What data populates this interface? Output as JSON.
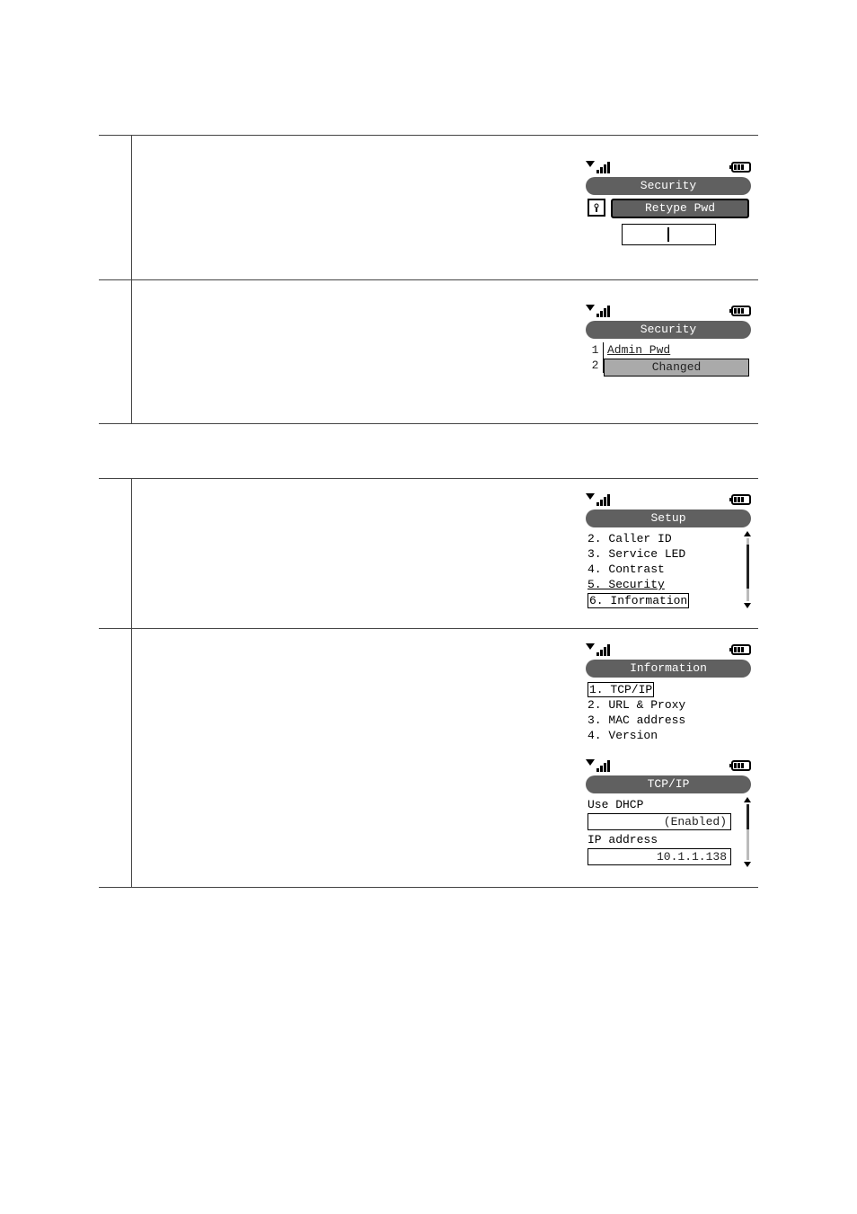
{
  "screen1": {
    "title": "Security",
    "retype_label": "Retype Pwd"
  },
  "screen2": {
    "title": "Security",
    "num1": "1",
    "num2": "2",
    "admin_pwd": "Admin Pwd",
    "changed": "Changed"
  },
  "screen3": {
    "title": "Setup",
    "items": {
      "i2": "2. Caller ID",
      "i3": "3. Service LED",
      "i4": "4. Contrast",
      "i5": "5. Security",
      "i6": "6. Information"
    }
  },
  "screen4": {
    "title": "Information",
    "items": {
      "i1": "1. TCP/IP",
      "i2": "2. URL & Proxy",
      "i3": "3. MAC address",
      "i4": "4. Version"
    }
  },
  "screen5": {
    "title": "TCP/IP",
    "use_dhcp_label": "Use DHCP",
    "use_dhcp_value": "(Enabled)",
    "ip_label": "IP address",
    "ip_value": "10.1.1.138"
  }
}
